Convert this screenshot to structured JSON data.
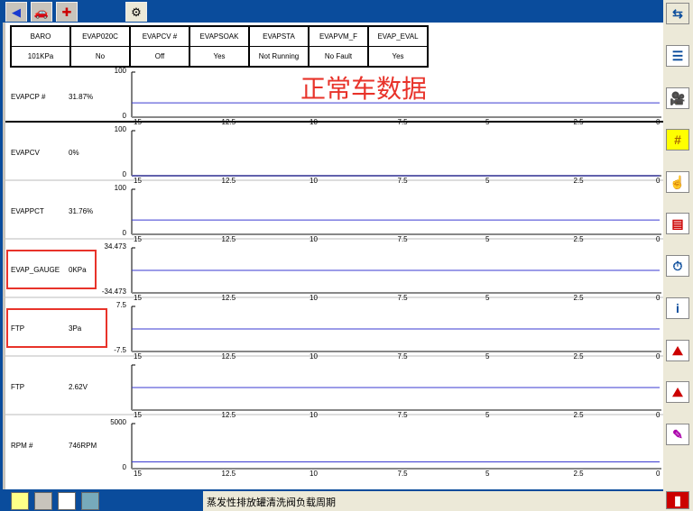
{
  "header": [
    {
      "name": "BARO",
      "value": "101KPa"
    },
    {
      "name": "EVAP020C",
      "value": "No"
    },
    {
      "name": "EVAPCV #",
      "value": "Off"
    },
    {
      "name": "EVAPSOAK",
      "value": "Yes"
    },
    {
      "name": "EVAPSTA",
      "value": "Not Running"
    },
    {
      "name": "EVAPVM_F",
      "value": "No Fault"
    },
    {
      "name": "EVAP_EVAL",
      "value": "Yes"
    }
  ],
  "overlay_title": "正常车数据",
  "x_ticks": [
    "15",
    "12.5",
    "10",
    "7.5",
    "5",
    "2.5",
    "0"
  ],
  "graphs": [
    {
      "name": "EVAPCP #",
      "value": "31.87%",
      "max": "100",
      "min": "0",
      "level": 0.3187,
      "highlight": false
    },
    {
      "name": "EVAPCV",
      "value": "0%",
      "max": "100",
      "min": "0",
      "level": 0,
      "highlight": false
    },
    {
      "name": "EVAPPCT",
      "value": "31.76%",
      "max": "100",
      "min": "0",
      "level": 0.3176,
      "highlight": false
    },
    {
      "name": "EVAP_GAUGE",
      "value": "0KPa",
      "max": "34.473",
      "min": "-34.473",
      "level": 0.5,
      "highlight": true
    },
    {
      "name": "FTP",
      "value": "3Pa",
      "max": "7.5",
      "min": "-7.5",
      "level": 0.5,
      "highlight": true
    },
    {
      "name": "FTP",
      "value": "2.62V",
      "max": "",
      "min": "",
      "level": 0.5,
      "highlight": false
    },
    {
      "name": "RPM #",
      "value": "746RPM",
      "max": "5000",
      "min": "0",
      "level": 0.149,
      "highlight": false
    }
  ],
  "status_text": "蒸发性排放罐清洗阀负载周期",
  "colors": {
    "trace": "#3a3ad0",
    "highlight": "#e8332a",
    "titlebar": "#0a4c9c"
  }
}
